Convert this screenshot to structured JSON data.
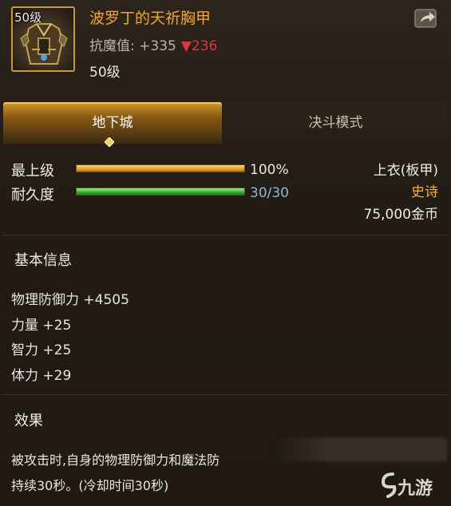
{
  "item": {
    "level_badge": "50级",
    "name": "波罗丁的天祈胸甲",
    "magic_resist_label": "抗魔值: +335",
    "magic_resist_down": "▼236",
    "level_text": "50级"
  },
  "tabs": [
    {
      "label": "地下城",
      "active": true
    },
    {
      "label": "决斗模式",
      "active": false
    }
  ],
  "stats": {
    "max_level_label": "最上级",
    "max_level_value": "100%",
    "max_level_fraction": 1.0,
    "durability_label": "耐久度",
    "durability_value": "30/30",
    "durability_fraction": 1.0
  },
  "info": {
    "slot": "上衣(板甲)",
    "rarity": "史诗",
    "price": "75,000金币"
  },
  "basic": {
    "title": "基本信息",
    "attributes": [
      "物理防御力 +4505",
      "力量 +25",
      "智力 +25",
      "体力 +29"
    ]
  },
  "effect": {
    "title": "效果",
    "line1": "被攻击时,自身的物理防御力和魔法防",
    "line2": "持续30秒。(冷却时间30秒)"
  },
  "watermark": {
    "text": "九游"
  },
  "colors": {
    "name_orange": "#f5a623",
    "rarity_gold": "#f5b31a",
    "decrease_red": "#e8313a",
    "durability_blue": "#8db7d6",
    "frame_gold": "#c89b2a"
  },
  "icons": [
    "armor-icon",
    "share-icon",
    "tab-marker-icon",
    "watermark-logo-icon"
  ]
}
